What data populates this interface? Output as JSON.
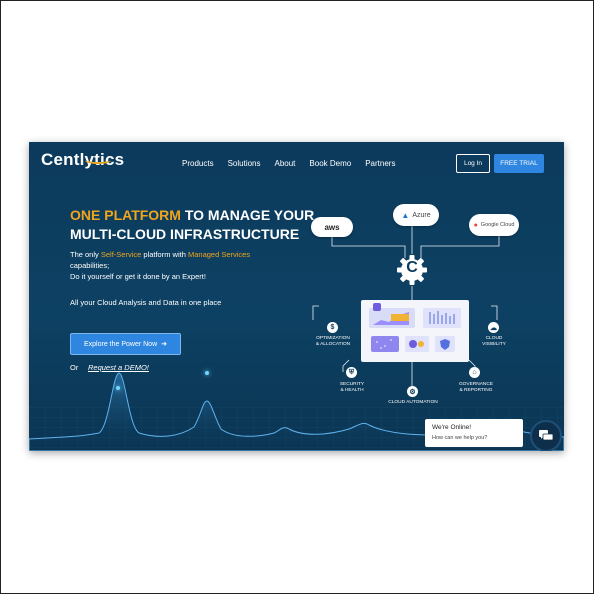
{
  "header": {
    "logo": "Centlytics",
    "nav": [
      "Products",
      "Solutions",
      "About",
      "Book Demo",
      "Partners"
    ],
    "login_label": "Log In",
    "trial_label": "FREE TRIAL"
  },
  "hero": {
    "headline_accent": "ONE PLATFORM",
    "headline_rest": " TO MANAGE YOUR",
    "headline_line2": "MULTI-CLOUD INFRASTRUCTURE",
    "tag_pre": "The only ",
    "tag_self": "Self-Service",
    "tag_mid": " platform with ",
    "tag_managed": "Managed Services",
    "tag_post": " capabilities;",
    "tag_line2": "Do it yourself or get it done by an Expert!",
    "tag_line3": "All your Cloud Analysis and Data in one place",
    "cta_label": "Explore the Power Now",
    "or_label": "Or",
    "demo_link": "Request a DEMO!"
  },
  "diagram": {
    "clouds": [
      "aws",
      "Azure",
      "Google Cloud"
    ],
    "center_letter": "C",
    "caption_left_top": [
      "OPTIMIZATION",
      "& ALLOCATION"
    ],
    "caption_right_top": [
      "CLOUD",
      "VISIBILITY"
    ],
    "caption_left_bottom": [
      "SECURITY",
      "& HEALTH"
    ],
    "caption_right_bottom": [
      "GOVERNANCE",
      "& REPORTING"
    ],
    "caption_bottom": "CLOUD AUTOMATION"
  },
  "chat": {
    "title": "We're Online!",
    "subtitle": "How can we help you?"
  },
  "colors": {
    "background": "#0c3a5c",
    "accent_orange": "#f2a51a",
    "button_blue": "#2f86e0"
  }
}
